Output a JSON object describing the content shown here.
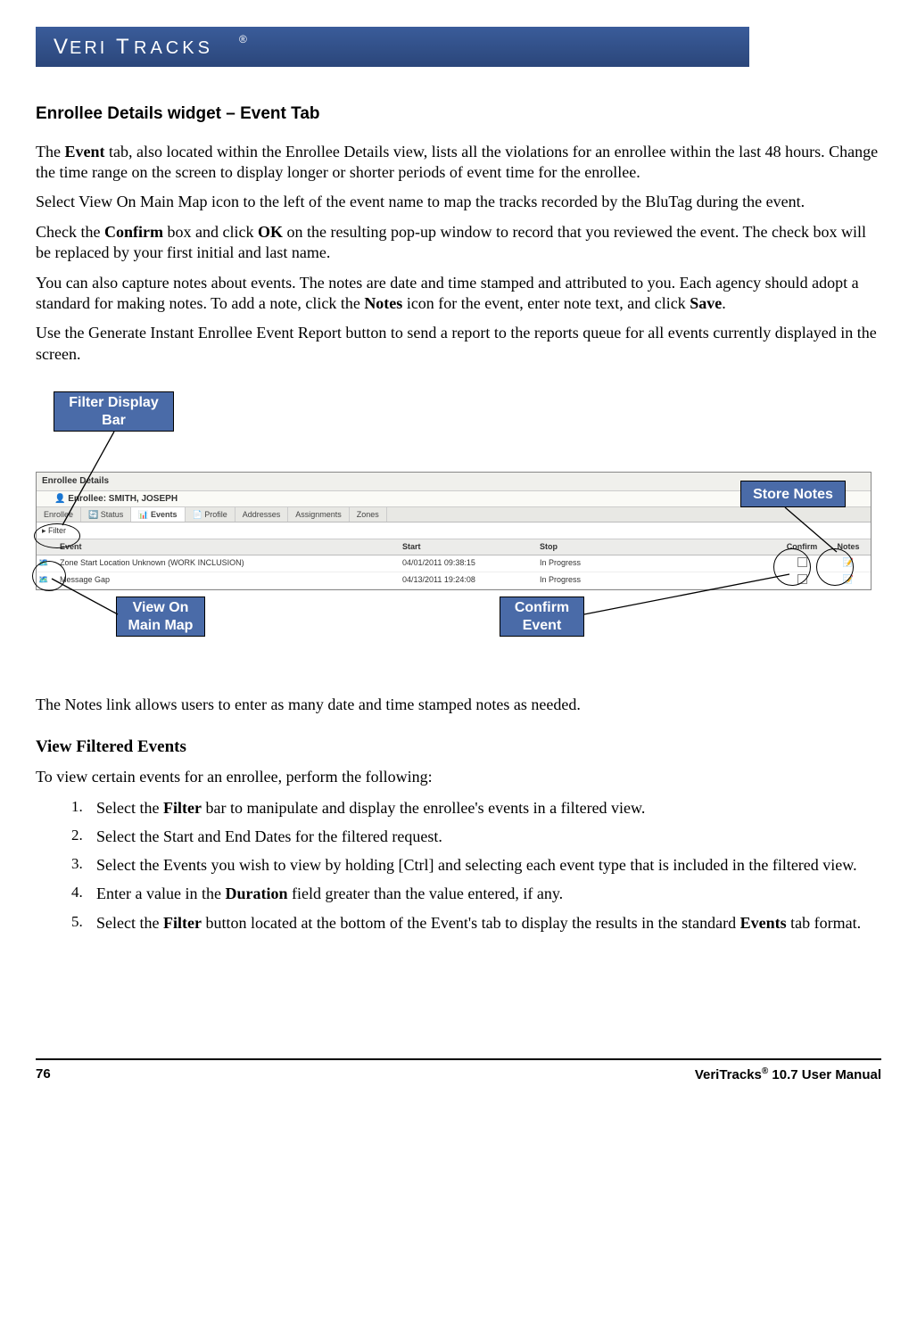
{
  "banner": {
    "brand": "VeriTracks",
    "reg": "®"
  },
  "heading": "Enrollee Details widget – Event Tab",
  "p1_pre": "The ",
  "p1_b": "Event",
  "p1_post": " tab, also located within the Enrollee Details view, lists all the violations for an enrollee within the last 48 hours. Change the time range on the screen to display longer or shorter periods of event time for the enrollee.",
  "p2": "Select View On Main Map icon to the left of the event name to map the tracks recorded by the BluTag during the event.",
  "p3_a": "Check the ",
  "p3_b1": "Confirm",
  "p3_c": " box and click ",
  "p3_b2": "OK",
  "p3_d": " on the resulting pop-up window to record that you reviewed the event.  The check box will be replaced by your first initial and last name.",
  "p4_a": "You can also capture notes about events. The notes are date and time stamped and attributed to you. Each agency should adopt a standard for making notes. To add a note, click the ",
  "p4_b1": "Notes",
  "p4_c": " icon for the event, enter note text, and click ",
  "p4_b2": "Save",
  "p4_d": ".",
  "p5": "Use the Generate Instant Enrollee Event Report button to send a report to the reports queue for all events currently displayed in the screen.",
  "callouts": {
    "filter": "Filter Display Bar",
    "view_map": "View On Main Map",
    "confirm": "Confirm Event",
    "notes": "Store Notes"
  },
  "ui": {
    "window_title": "Enrollee Details",
    "enrollee": "Enrollee: SMITH, JOSEPH",
    "tabs": [
      "Enrollee",
      "Status",
      "Events",
      "Profile",
      "Addresses",
      "Assignments",
      "Zones"
    ],
    "filter_label": "Filter",
    "cols": {
      "event": "Event",
      "start": "Start",
      "stop": "Stop",
      "confirm": "Confirm",
      "notes": "Notes"
    },
    "rows": [
      {
        "event": "Zone Start Location Unknown (WORK INCLUSION)",
        "start": "04/01/2011 09:38:15",
        "stop": "In Progress"
      },
      {
        "event": "Message Gap",
        "start": "04/13/2011 19:24:08",
        "stop": "In Progress"
      }
    ]
  },
  "p6": "The Notes link allows users to enter as many date and time stamped notes as needed.",
  "sub2": "View Filtered Events",
  "p7": "To view certain events for an enrollee, perform the following:",
  "steps": [
    {
      "n": "1.",
      "pre": "Select the ",
      "b": "Filter",
      "post": " bar to manipulate and display the enrollee's events in a filtered view."
    },
    {
      "n": "2.",
      "pre": "Select the Start and End Dates for the filtered request.",
      "b": "",
      "post": ""
    },
    {
      "n": "3.",
      "pre": "Select the Events you wish to view by holding [Ctrl] and selecting each event type that is included in the filtered view.",
      "b": "",
      "post": ""
    },
    {
      "n": "4.",
      "pre": "Enter a value in the ",
      "b": "Duration",
      "post": " field greater than the value entered, if any."
    },
    {
      "n": "5.",
      "pre": "Select the ",
      "b": "Filter",
      "post": " button located at the bottom of the Event's tab to display the results in the standard ",
      "b2": "Events",
      "post2": " tab format."
    }
  ],
  "footer": {
    "page": "76",
    "title_a": "VeriTracks",
    "title_b": " 10.7 User Manual"
  }
}
